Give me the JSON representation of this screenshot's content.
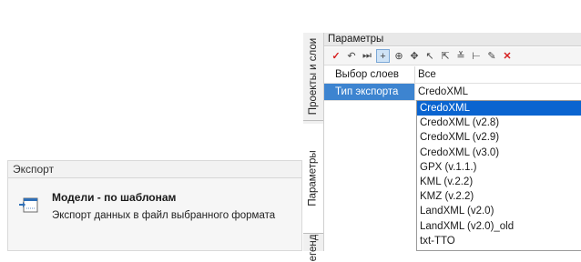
{
  "export_panel": {
    "header": "Экспорт",
    "item_title": "Модели - по шаблонам",
    "item_desc": "Экспорт данных в файл выбранного формата"
  },
  "vertical_tabs": [
    "Проекты и слои",
    "Параметры",
    "Легенда"
  ],
  "params_panel": {
    "title": "Параметры",
    "rows": [
      {
        "label": "Выбор слоев",
        "value": "Все"
      },
      {
        "label": "Тип экспорта",
        "value": "CredoXML"
      }
    ]
  },
  "dropdown": {
    "highlighted": "CredoXML",
    "options": [
      "CredoXML",
      "CredoXML (v2.8)",
      "CredoXML (v2.9)",
      "CredoXML (v3.0)",
      "GPX (v.1.1.)",
      "KML (v.2.2)",
      "KMZ (v.2.2)",
      "LandXML (v2.0)",
      "LandXML (v2.0)_old",
      "txt-TTO"
    ]
  },
  "toolbar_icons": [
    "check-icon",
    "undo-icon",
    "skip-icon",
    "crosshair-icon",
    "move-icon",
    "move-alt-icon",
    "select-arrow-icon",
    "select-text-icon",
    "align-icon",
    "split-icon",
    "eyedropper-icon",
    "close-icon"
  ],
  "colors": {
    "selection": "#3d84d0",
    "highlight": "#0a64d0",
    "cancel": "#d62020"
  }
}
